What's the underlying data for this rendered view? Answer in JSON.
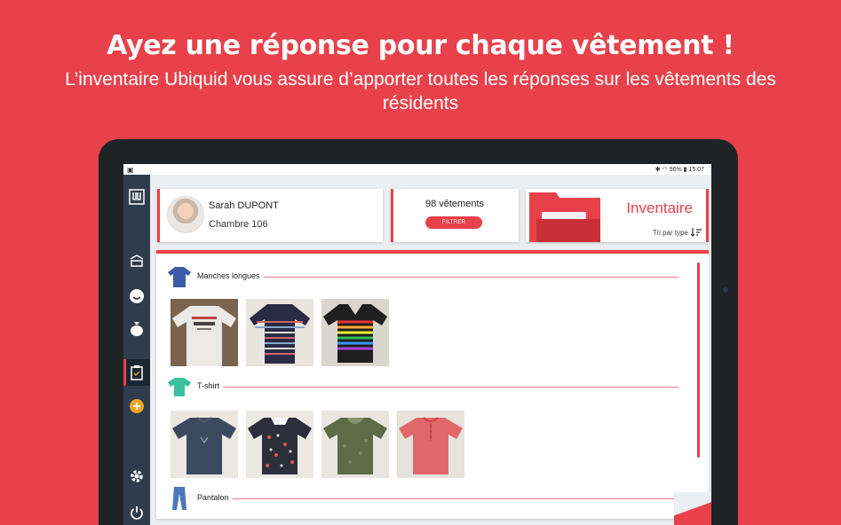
{
  "header": {
    "headline": "Ayez une réponse pour chaque vêtement !",
    "subline": "L’inventaire Ubiquid vous assure d’apporter toutes les réponses sur les vêtements des résidents"
  },
  "statusbar": {
    "battery": "96%",
    "time": "15:07"
  },
  "sidebar": {
    "items": [
      {
        "icon": "logo-icon"
      },
      {
        "icon": "building-icon"
      },
      {
        "icon": "smiley-icon"
      },
      {
        "icon": "laundry-bag-icon"
      },
      {
        "icon": "clipboard-check-icon",
        "active": true
      },
      {
        "icon": "plus-circle-icon"
      },
      {
        "icon": "gear-icon"
      },
      {
        "icon": "power-icon"
      }
    ]
  },
  "resident": {
    "name": "Sarah DUPONT",
    "room": "Chambre 106"
  },
  "summary": {
    "count_label": "98 vêtements",
    "filter_label": "FILTRER"
  },
  "inventory": {
    "title": "Inventaire",
    "sort_label": "Tri par type"
  },
  "sections": [
    {
      "label": "Manches longues",
      "items": [
        "hollister-longsleeve",
        "striped-longsleeve",
        "rainbow-stripe-top"
      ]
    },
    {
      "label": "T-shirt",
      "items": [
        "navy-tshirt",
        "floral-blouse",
        "olive-lace-tshirt",
        "coral-tshirt"
      ]
    },
    {
      "label": "Pantalon",
      "items": []
    }
  ],
  "colors": {
    "accent": "#e8414b",
    "sidebar": "#2e3c4c",
    "tablet": "#1f2326"
  }
}
